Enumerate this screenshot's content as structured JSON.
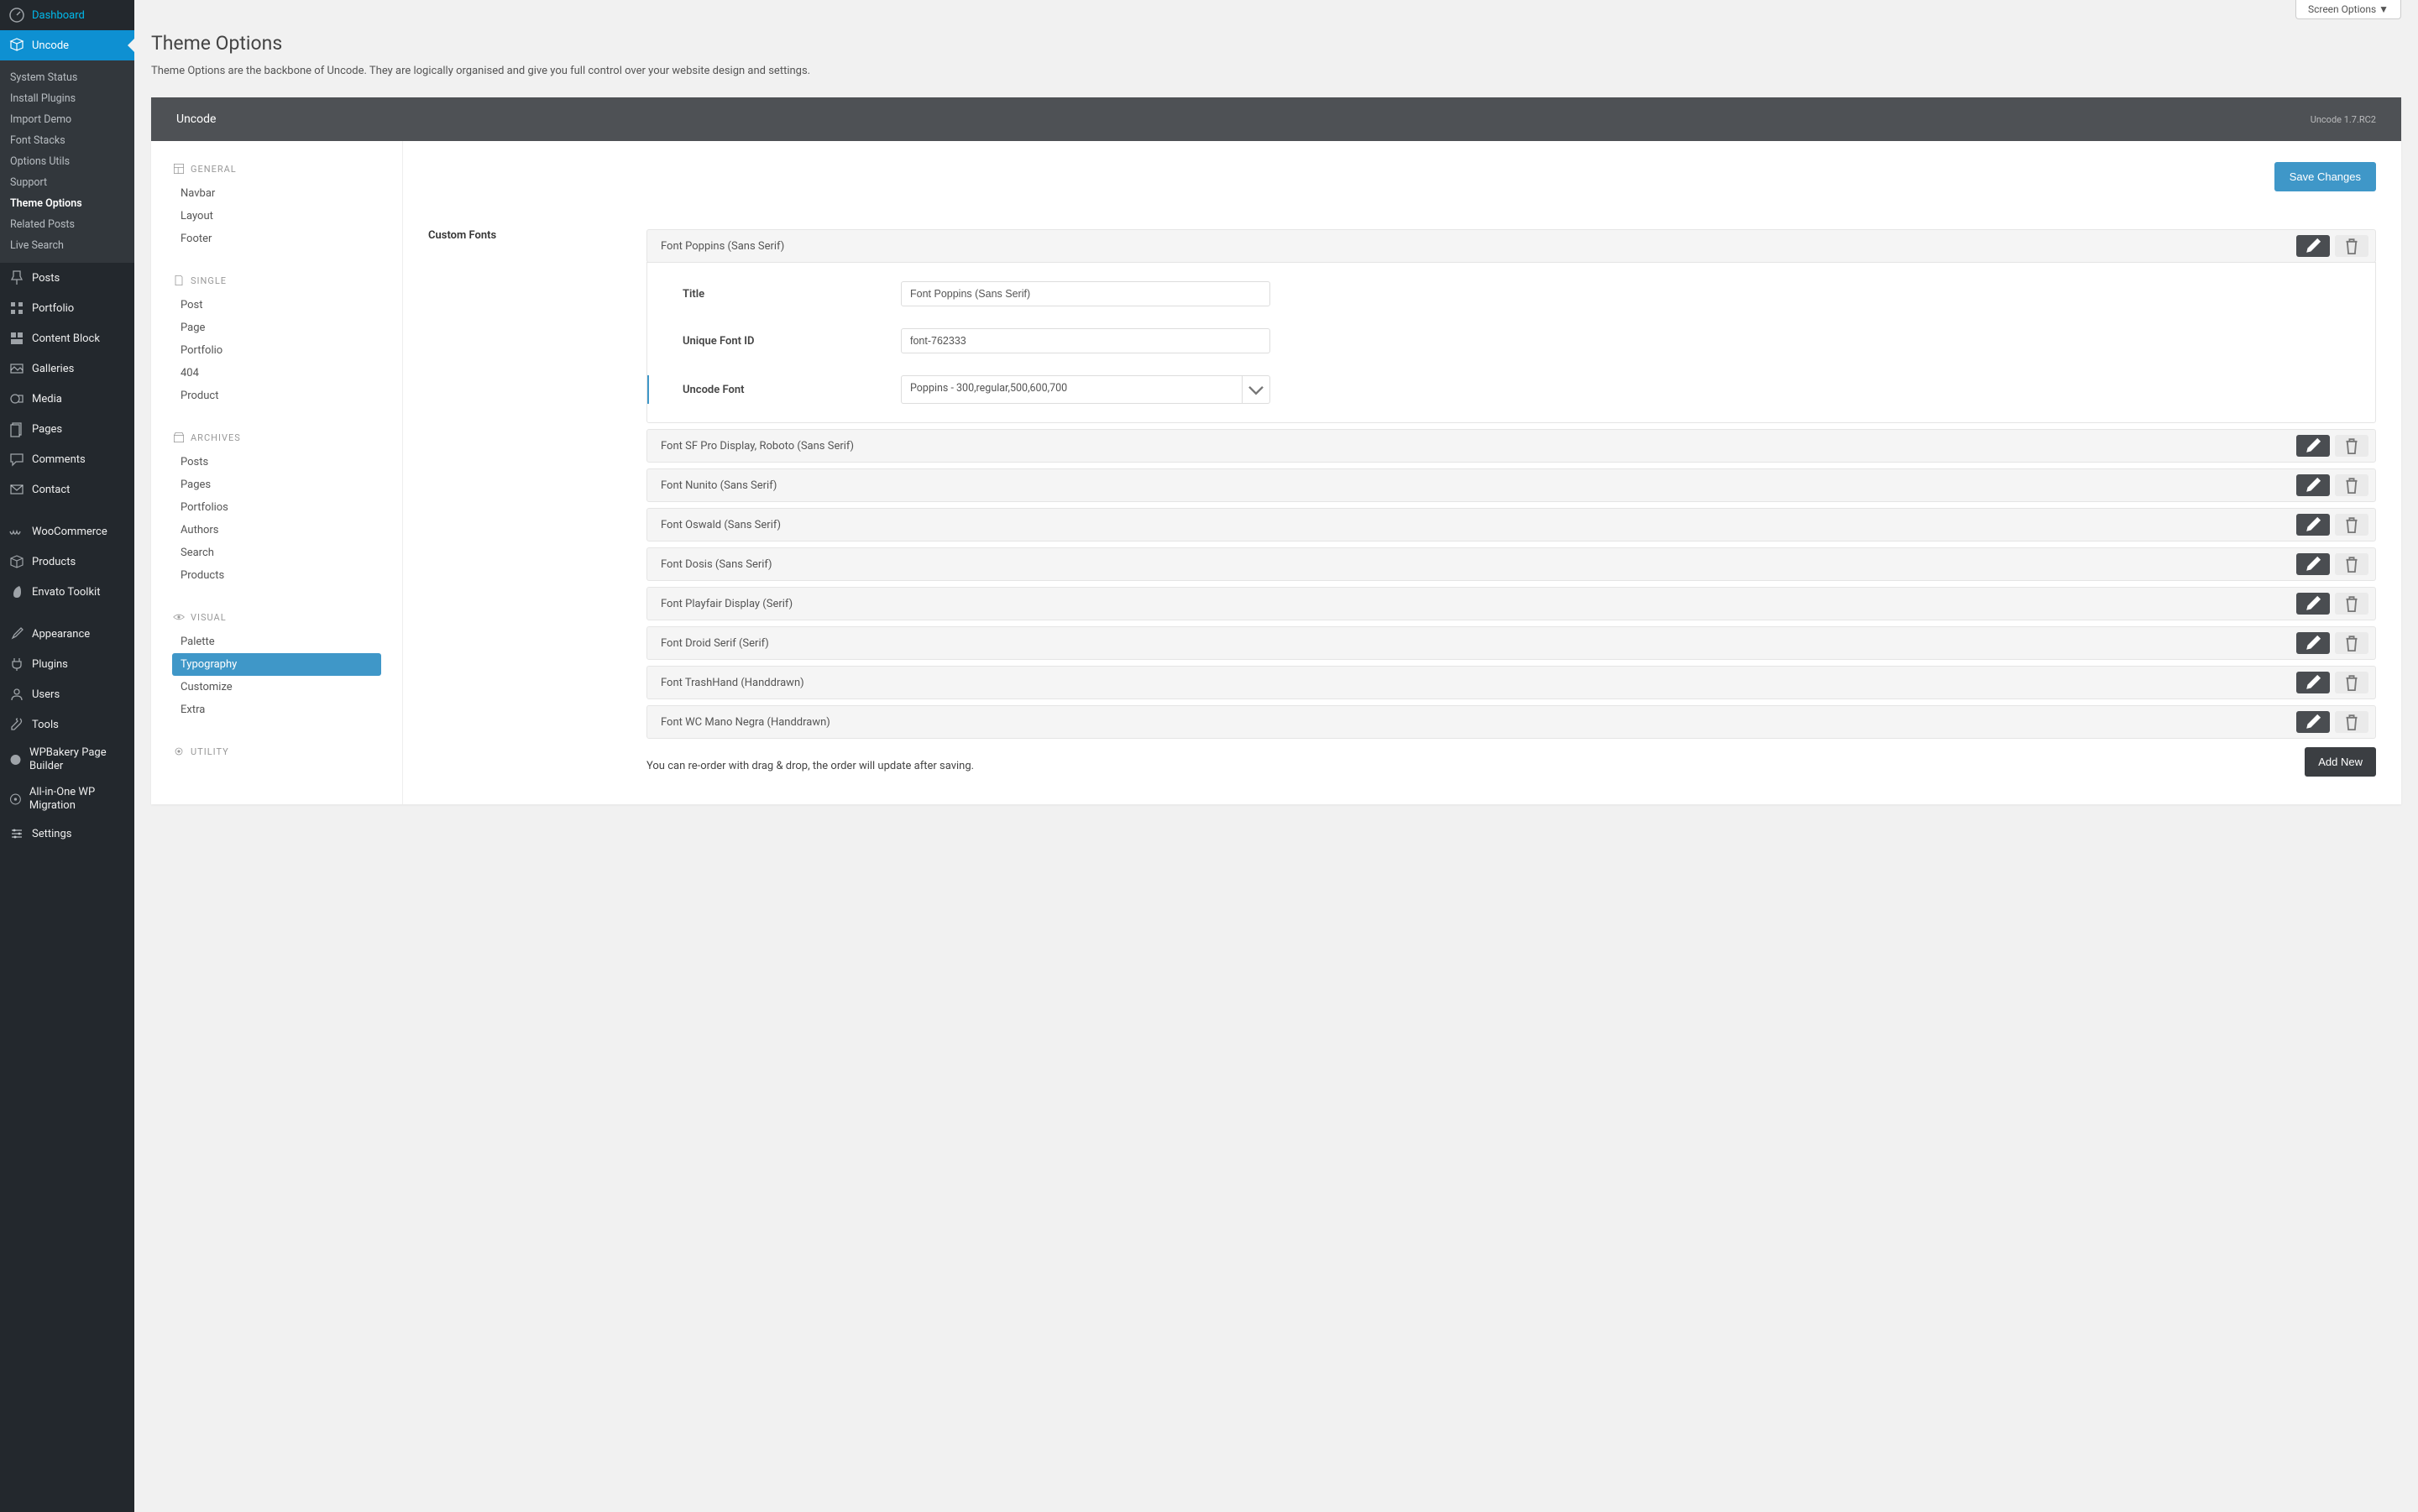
{
  "screen_options": "Screen Options ▼",
  "page": {
    "title": "Theme Options",
    "desc": "Theme Options are the backbone of Uncode. They are logically organised and give you full control over your website design and settings."
  },
  "sidebar": {
    "items": [
      {
        "label": "Dashboard",
        "icon": "dashboard-icon"
      },
      {
        "label": "Uncode",
        "icon": "uncode-icon",
        "active": true
      },
      {
        "label": "Posts",
        "icon": "pin-icon"
      },
      {
        "label": "Portfolio",
        "icon": "grid-icon"
      },
      {
        "label": "Content Block",
        "icon": "blocks-icon"
      },
      {
        "label": "Galleries",
        "icon": "gallery-icon"
      },
      {
        "label": "Media",
        "icon": "media-icon"
      },
      {
        "label": "Pages",
        "icon": "pages-icon"
      },
      {
        "label": "Comments",
        "icon": "comment-icon"
      },
      {
        "label": "Contact",
        "icon": "mail-icon"
      },
      {
        "label": "WooCommerce",
        "icon": "cart-icon"
      },
      {
        "label": "Products",
        "icon": "box-icon"
      },
      {
        "label": "Envato Toolkit",
        "icon": "envato-icon"
      },
      {
        "label": "Appearance",
        "icon": "brush-icon"
      },
      {
        "label": "Plugins",
        "icon": "plug-icon"
      },
      {
        "label": "Users",
        "icon": "user-icon"
      },
      {
        "label": "Tools",
        "icon": "wrench-icon"
      },
      {
        "label": "WPBakery Page Builder",
        "icon": "wpb-icon"
      },
      {
        "label": "All-in-One WP Migration",
        "icon": "migration-icon"
      },
      {
        "label": "Settings",
        "icon": "settings-icon"
      }
    ],
    "submenu": [
      "System Status",
      "Install Plugins",
      "Import Demo",
      "Font Stacks",
      "Options Utils",
      "Support",
      "Theme Options",
      "Related Posts",
      "Live Search"
    ],
    "submenu_current": "Theme Options"
  },
  "panel": {
    "title": "Uncode",
    "version": "Uncode 1.7.RC2",
    "save": "Save Changes",
    "add_new": "Add New"
  },
  "sections": {
    "groups": [
      {
        "head": "GENERAL",
        "icon": "layout-icon",
        "items": [
          "Navbar",
          "Layout",
          "Footer"
        ]
      },
      {
        "head": "SINGLE",
        "icon": "page-icon",
        "items": [
          "Post",
          "Page",
          "Portfolio",
          "404",
          "Product"
        ]
      },
      {
        "head": "ARCHIVES",
        "icon": "archive-icon",
        "items": [
          "Posts",
          "Pages",
          "Portfolios",
          "Authors",
          "Search",
          "Products"
        ]
      },
      {
        "head": "VISUAL",
        "icon": "eye-icon",
        "items": [
          "Palette",
          "Typography",
          "Customize",
          "Extra"
        ],
        "active": "Typography"
      },
      {
        "head": "UTILITY",
        "icon": "gear-icon",
        "items": []
      }
    ]
  },
  "custom_fonts": {
    "label": "Custom Fonts",
    "note": "You can re-order with drag & drop, the order will update after saving.",
    "edit_labels": {
      "title": "Title",
      "id": "Unique Font ID",
      "uncode_font": "Uncode Font"
    },
    "expanded": {
      "title": "Font Poppins (Sans Serif)",
      "id": "font-762333",
      "select": "Poppins - 300,regular,500,600,700"
    },
    "rows": [
      "Font Poppins (Sans Serif)",
      "Font SF Pro Display, Roboto (Sans Serif)",
      "Font Nunito (Sans Serif)",
      "Font Oswald (Sans Serif)",
      "Font Dosis (Sans Serif)",
      "Font Playfair Display (Serif)",
      "Font Droid Serif (Serif)",
      "Font TrashHand (Handdrawn)",
      "Font WC Mano Negra (Handdrawn)"
    ]
  }
}
